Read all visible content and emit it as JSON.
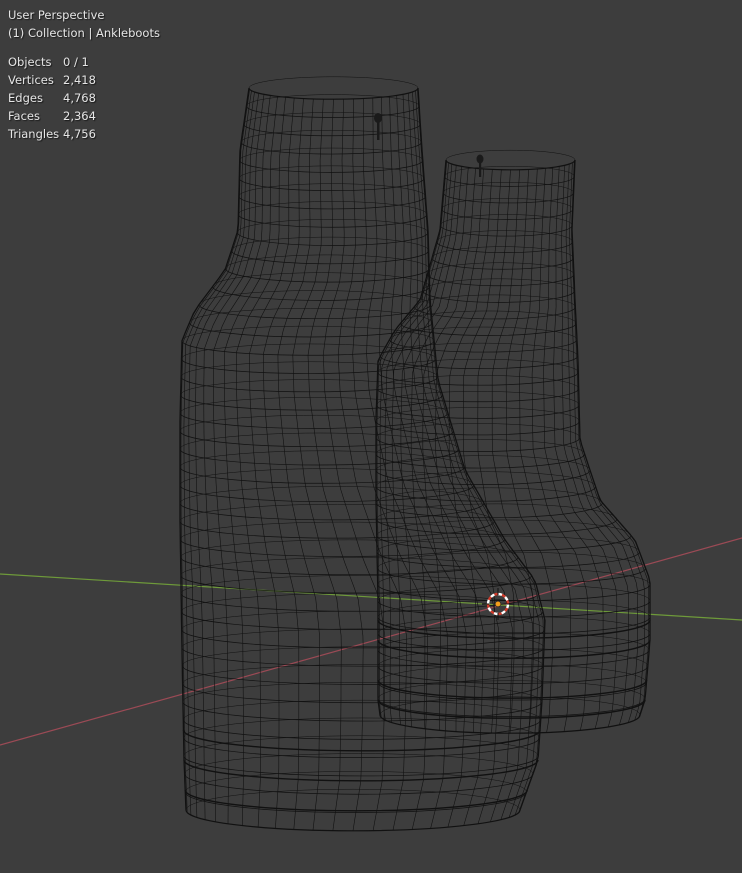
{
  "viewport": {
    "view_name": "User Perspective",
    "collection_line": "(1) Collection | Ankleboots",
    "stats": [
      {
        "label": "Objects",
        "value": "0 / 1"
      },
      {
        "label": "Vertices",
        "value": "2,418"
      },
      {
        "label": "Edges",
        "value": "4,768"
      },
      {
        "label": "Faces",
        "value": "2,364"
      },
      {
        "label": "Triangles",
        "value": "4,756"
      }
    ]
  },
  "colors": {
    "background": "#3d3d3d",
    "wire": "#111111",
    "x_axis": "#9b4a55",
    "y_axis": "#6e9a3a",
    "cursor_red": "#d23a2a",
    "cursor_white": "#ffffff",
    "origin": "#f29d1b"
  },
  "icons": [
    "3d-cursor-icon",
    "origin-point-icon"
  ]
}
